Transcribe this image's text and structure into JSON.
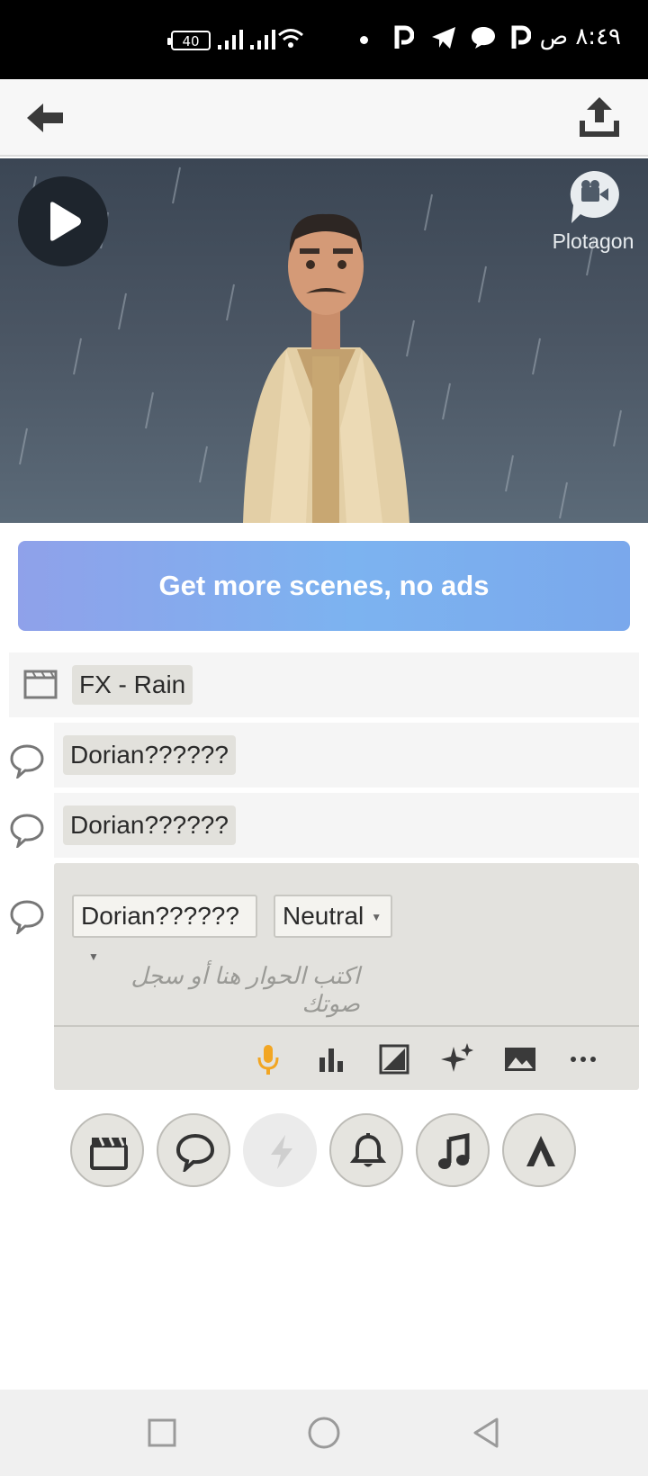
{
  "status_bar": {
    "time": "٨:٤٩ ص",
    "battery": "40"
  },
  "app_bar": {
    "back_icon": "arrow-left-icon",
    "share_icon": "share-upload-icon"
  },
  "video": {
    "brand_name": "Plotagon",
    "play_icon": "play-icon"
  },
  "promo": {
    "label": "Get more scenes, no ads"
  },
  "scene_rows": [
    {
      "type": "scene",
      "icon": "clapperboard-icon",
      "label": "FX - Rain"
    },
    {
      "type": "dialogue",
      "icon": "speech-bubble-icon",
      "label": "Dorian??????"
    },
    {
      "type": "dialogue",
      "icon": "speech-bubble-icon",
      "label": "Dorian??????"
    }
  ],
  "editor": {
    "character": "Dorian??????",
    "mood": "Neutral",
    "placeholder": "اكتب الحوار هنا أو سجل صوتك",
    "tools": [
      "microphone-icon",
      "bar-chart-icon",
      "image-contrast-icon",
      "sparkles-icon",
      "picture-icon",
      "more-icon"
    ],
    "accent_color": "#f2a623"
  },
  "add_buttons": [
    "clapperboard-icon",
    "speech-bubble-icon",
    "lightning-icon",
    "bell-icon",
    "music-note-icon",
    "text-a-icon"
  ],
  "nav_bar": [
    "square-icon",
    "circle-icon",
    "triangle-back-icon"
  ]
}
